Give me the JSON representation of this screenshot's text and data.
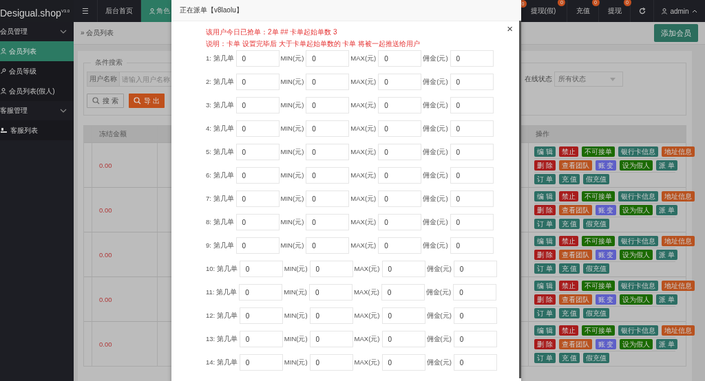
{
  "sidebar": {
    "logo": "Desigual.shop$^{V3.0}$",
    "groups": [
      {
        "title": "会员管理",
        "expanded": true,
        "items": [
          {
            "label": "会员列表",
            "kind": "user",
            "selected": true
          },
          {
            "label": "会员等级",
            "kind": "key",
            "selected": false
          },
          {
            "label": "会员列表(假人)",
            "kind": "user",
            "selected": false
          }
        ]
      },
      {
        "title": "客服管理",
        "expanded": true,
        "items": [
          {
            "label": "客服列表",
            "kind": "team",
            "selected": false
          }
        ]
      }
    ]
  },
  "topbar": {
    "menu_icon": "☰",
    "tabs": [
      {
        "label": "后台首页",
        "kind": "plain",
        "selected": false
      },
      {
        "label": "角色",
        "kind": "user",
        "selected": true
      }
    ],
    "notifications": [
      {
        "badge": "0"
      },
      {
        "label": "提现(假)",
        "badge": "0"
      },
      {
        "label": "充值",
        "badge": "0"
      },
      {
        "label": "提现",
        "badge": "0"
      }
    ],
    "user": "admin"
  },
  "breadcrumb": "» 会员列表",
  "add_button": "添加会员",
  "filter": {
    "legend": "条件搜索",
    "username_label": "用户名称",
    "username_placeholder": "请输入用户名称",
    "status_label": "在线状态",
    "status_value": "所有状态",
    "search_button": "搜 索",
    "export_button": "导 出"
  },
  "table": {
    "columns": [
      "冻结金额",
      "操作"
    ],
    "rows": [
      {
        "frozen": "0.00",
        "actions": [
          [
            {
              "label": "编 辑",
              "color": "#2c6e64"
            },
            {
              "label": "禁止",
              "color": "#a81c1c"
            },
            {
              "label": "不可接单",
              "color": "#1b6a00"
            },
            {
              "label": "银行卡信息",
              "color": "#2c6e64"
            },
            {
              "label": "地址信息",
              "color": "#b8521f"
            }
          ],
          [
            {
              "label": "删 除",
              "color": "#a81c1c"
            },
            {
              "label": "查看团队",
              "color": "#b8521f"
            },
            {
              "label": "账 变",
              "color": "#5e5fc8"
            },
            {
              "label": "设为假人",
              "color": "#1b6a00"
            },
            {
              "label": "派 单",
              "color": "#2c6e64"
            }
          ],
          [
            {
              "label": "订 单",
              "color": "#2c6e64"
            },
            {
              "label": "充 值",
              "color": "#2c6e64"
            },
            {
              "label": "假充值",
              "color": "#2c6e64"
            }
          ]
        ]
      },
      {
        "frozen": "0.00",
        "actions": [
          [
            {
              "label": "编 辑",
              "color": "#2c6e64"
            },
            {
              "label": "禁止",
              "color": "#a81c1c"
            },
            {
              "label": "不可接单",
              "color": "#1b6a00"
            },
            {
              "label": "银行卡信息",
              "color": "#2c6e64"
            },
            {
              "label": "地址信息",
              "color": "#b8521f"
            }
          ],
          [
            {
              "label": "删 除",
              "color": "#a81c1c"
            },
            {
              "label": "查看团队",
              "color": "#b8521f"
            },
            {
              "label": "账 变",
              "color": "#5e5fc8"
            },
            {
              "label": "设为假人",
              "color": "#1b6a00"
            },
            {
              "label": "派 单",
              "color": "#2c6e64"
            }
          ],
          [
            {
              "label": "订 单",
              "color": "#2c6e64"
            },
            {
              "label": "充 值",
              "color": "#2c6e64"
            },
            {
              "label": "假充值",
              "color": "#2c6e64"
            }
          ]
        ]
      },
      {
        "frozen": "0.00",
        "actions": [
          [
            {
              "label": "编 辑",
              "color": "#2c6e64"
            },
            {
              "label": "禁止",
              "color": "#a81c1c"
            },
            {
              "label": "不可接单",
              "color": "#1b6a00"
            },
            {
              "label": "银行卡信息",
              "color": "#2c6e64"
            },
            {
              "label": "地址信息",
              "color": "#b8521f"
            }
          ],
          [
            {
              "label": "删 除",
              "color": "#a81c1c"
            },
            {
              "label": "查看团队",
              "color": "#b8521f"
            },
            {
              "label": "账 变",
              "color": "#5e5fc8"
            },
            {
              "label": "设为假人",
              "color": "#1b6a00"
            },
            {
              "label": "派 单",
              "color": "#2c6e64"
            }
          ],
          [
            {
              "label": "订 单",
              "color": "#2c6e64"
            },
            {
              "label": "充 值",
              "color": "#2c6e64"
            },
            {
              "label": "假充值",
              "color": "#2c6e64"
            }
          ]
        ]
      },
      {
        "frozen": "0.00",
        "actions": [
          [
            {
              "label": "编 辑",
              "color": "#2c6e64"
            },
            {
              "label": "禁止",
              "color": "#a81c1c"
            },
            {
              "label": "不可接单",
              "color": "#1b6a00"
            },
            {
              "label": "银行卡信息",
              "color": "#2c6e64"
            },
            {
              "label": "地址信息",
              "color": "#b8521f"
            }
          ],
          [
            {
              "label": "删 除",
              "color": "#a81c1c"
            },
            {
              "label": "查看团队",
              "color": "#b8521f"
            },
            {
              "label": "账 变",
              "color": "#5e5fc8"
            },
            {
              "label": "设为假人",
              "color": "#1b6a00"
            },
            {
              "label": "派 单",
              "color": "#2c6e64"
            }
          ],
          [
            {
              "label": "订 单",
              "color": "#2c6e64"
            },
            {
              "label": "充 值",
              "color": "#2c6e64"
            },
            {
              "label": "假充值",
              "color": "#2c6e64"
            }
          ]
        ]
      },
      {
        "frozen": "0.00",
        "actions": [
          [
            {
              "label": "编 辑",
              "color": "#2c6e64"
            },
            {
              "label": "禁止",
              "color": "#a81c1c"
            },
            {
              "label": "不可接单",
              "color": "#1b6a00"
            },
            {
              "label": "银行卡信息",
              "color": "#2c6e64"
            },
            {
              "label": "地址信息",
              "color": "#b8521f"
            }
          ],
          [
            {
              "label": "删 除",
              "color": "#a81c1c"
            },
            {
              "label": "查看团队",
              "color": "#b8521f"
            },
            {
              "label": "账 变",
              "color": "#5e5fc8"
            },
            {
              "label": "设为假人",
              "color": "#1b6a00"
            },
            {
              "label": "派 单",
              "color": "#2c6e64"
            }
          ],
          [
            {
              "label": "订 单",
              "color": "#2c6e64"
            },
            {
              "label": "充 值",
              "color": "#2c6e64"
            },
            {
              "label": "假充值",
              "color": "#2c6e64"
            }
          ]
        ]
      }
    ]
  },
  "modal": {
    "title": "正在派单【v8laolu】",
    "close": "×",
    "notice": "该用户今日已抢单：2单 ## 卡单起始单数 3",
    "explanation": "说明：卡单 设置完毕后 大于卡单起始单数的 卡单 将被一起推送给用户",
    "rows": [
      {
        "cells": [
          {
            "label": "1: 第几单",
            "value": "0"
          },
          {
            "label": "MIN(元)",
            "value": "0"
          },
          {
            "label": "MAX(元)",
            "value": "0"
          },
          {
            "label": "佣金(元)",
            "value": "0"
          }
        ]
      },
      {
        "cells": [
          {
            "label": "2: 第几单",
            "value": "0"
          },
          {
            "label": "MIN(元)",
            "value": "0"
          },
          {
            "label": "MAX(元)",
            "value": "0"
          },
          {
            "label": "佣金(元)",
            "value": "0"
          }
        ]
      },
      {
        "cells": [
          {
            "label": "3: 第几单",
            "value": "0"
          },
          {
            "label": "MIN(元)",
            "value": "0"
          },
          {
            "label": "MAX(元)",
            "value": "0"
          },
          {
            "label": "佣金(元)",
            "value": "0"
          }
        ]
      },
      {
        "cells": [
          {
            "label": "4: 第几单",
            "value": "0"
          },
          {
            "label": "MIN(元)",
            "value": "0"
          },
          {
            "label": "MAX(元)",
            "value": "0"
          },
          {
            "label": "佣金(元)",
            "value": "0"
          }
        ]
      },
      {
        "cells": [
          {
            "label": "5: 第几单",
            "value": "0"
          },
          {
            "label": "MIN(元)",
            "value": "0"
          },
          {
            "label": "MAX(元)",
            "value": "0"
          },
          {
            "label": "佣金(元)",
            "value": "0"
          }
        ]
      },
      {
        "cells": [
          {
            "label": "6: 第几单",
            "value": "0"
          },
          {
            "label": "MIN(元)",
            "value": "0"
          },
          {
            "label": "MAX(元)",
            "value": "0"
          },
          {
            "label": "佣金(元)",
            "value": "0"
          }
        ]
      },
      {
        "cells": [
          {
            "label": "7: 第几单",
            "value": "0"
          },
          {
            "label": "MIN(元)",
            "value": "0"
          },
          {
            "label": "MAX(元)",
            "value": "0"
          },
          {
            "label": "佣金(元)",
            "value": "0"
          }
        ]
      },
      {
        "cells": [
          {
            "label": "8: 第几单",
            "value": "0"
          },
          {
            "label": "MIN(元)",
            "value": "0"
          },
          {
            "label": "MAX(元)",
            "value": "0"
          },
          {
            "label": "佣金(元)",
            "value": "0"
          }
        ]
      },
      {
        "cells": [
          {
            "label": "9: 第几单",
            "value": "0"
          },
          {
            "label": "MIN(元)",
            "value": "0"
          },
          {
            "label": "MAX(元)",
            "value": "0"
          },
          {
            "label": "佣金(元)",
            "value": "0"
          }
        ]
      },
      {
        "cells": [
          {
            "label": "10: 第几单",
            "value": "0"
          },
          {
            "label": "MIN(元)",
            "value": "0"
          },
          {
            "label": "MAX(元)",
            "value": "0"
          },
          {
            "label": "佣金(元)",
            "value": "0"
          }
        ]
      },
      {
        "cells": [
          {
            "label": "11: 第几单",
            "value": "0"
          },
          {
            "label": "MIN(元)",
            "value": "0"
          },
          {
            "label": "MAX(元)",
            "value": "0"
          },
          {
            "label": "佣金(元)",
            "value": "0"
          }
        ]
      },
      {
        "cells": [
          {
            "label": "12: 第几单",
            "value": "0"
          },
          {
            "label": "MIN(元)",
            "value": "0"
          },
          {
            "label": "MAX(元)",
            "value": "0"
          },
          {
            "label": "佣金(元)",
            "value": "0"
          }
        ]
      },
      {
        "cells": [
          {
            "label": "13: 第几单",
            "value": "0"
          },
          {
            "label": "MIN(元)",
            "value": "0"
          },
          {
            "label": "MAX(元)",
            "value": "0"
          },
          {
            "label": "佣金(元)",
            "value": "0"
          }
        ]
      },
      {
        "cells": [
          {
            "label": "14: 第几单",
            "value": "0"
          },
          {
            "label": "MIN(元)",
            "value": "0"
          },
          {
            "label": "MAX(元)",
            "value": "0"
          },
          {
            "label": "佣金(元)",
            "value": "0"
          }
        ]
      }
    ]
  }
}
